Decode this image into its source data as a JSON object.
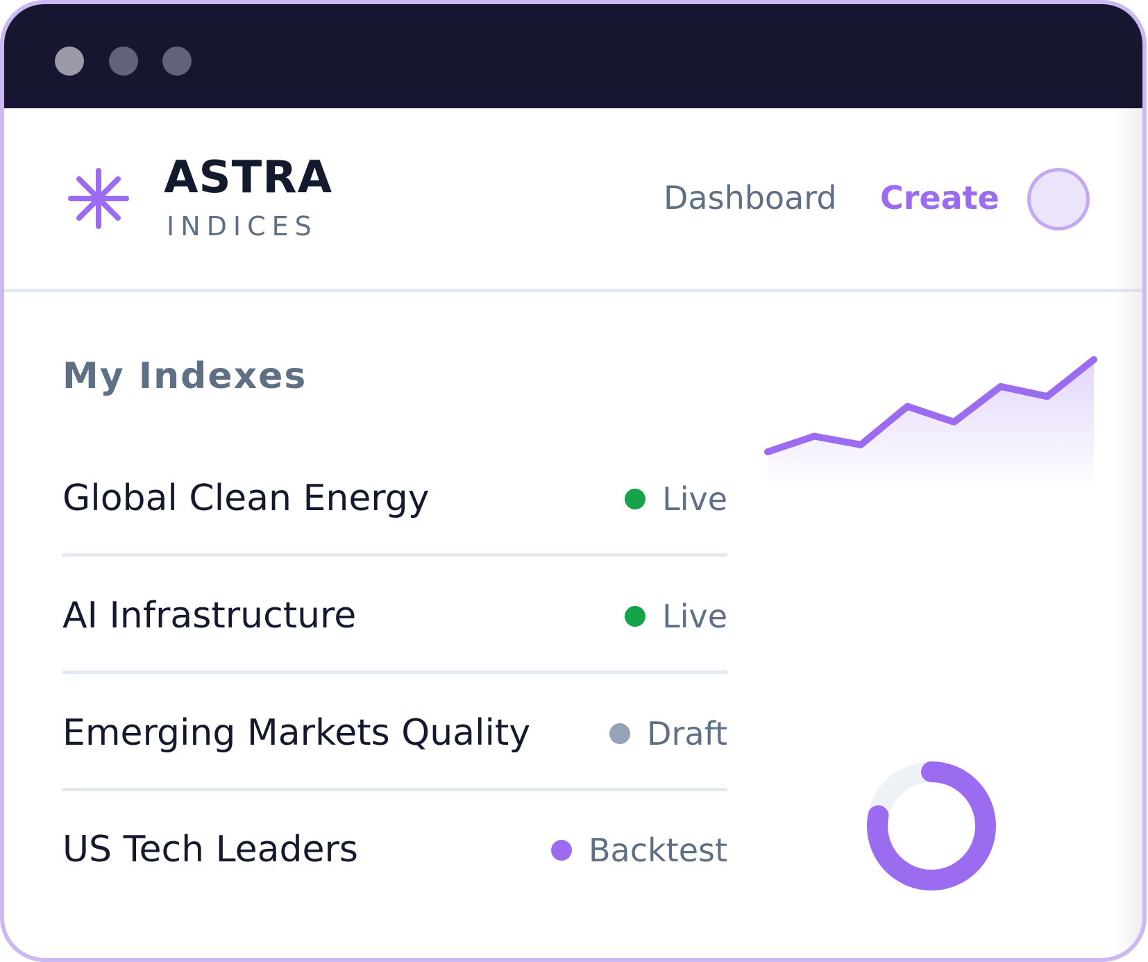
{
  "window": {
    "controls": [
      "close-dot",
      "minimize-dot",
      "maximize-dot"
    ]
  },
  "brand": {
    "name": "ASTRA",
    "subtitle": "INDICES",
    "icon": "asterisk-icon",
    "accent_color": "#9b6cf0"
  },
  "nav": {
    "dashboard_label": "Dashboard",
    "create_label": "Create",
    "active": "Create"
  },
  "main": {
    "title": "My Indexes",
    "indexes": [
      {
        "name": "Global Clean Energy",
        "status": "Live",
        "status_color": "#16a34a"
      },
      {
        "name": "AI Infrastructure",
        "status": "Live",
        "status_color": "#16a34a"
      },
      {
        "name": "Emerging Markets Quality",
        "status": "Draft",
        "status_color": "#94a3b8"
      },
      {
        "name": "US Tech Leaders",
        "status": "Backtest",
        "status_color": "#9b6cf0"
      }
    ]
  },
  "decor": {
    "sparkline_values": [
      1.0,
      2.1,
      1.5,
      4.2,
      3.1,
      5.6,
      4.9,
      7.5
    ],
    "donut_fraction": 0.78
  },
  "colors": {
    "titlebar": "#161630",
    "accent": "#9b6cf0",
    "border": "#cdb9f2",
    "text_primary": "#141a2e",
    "text_secondary": "#5f6f86"
  }
}
